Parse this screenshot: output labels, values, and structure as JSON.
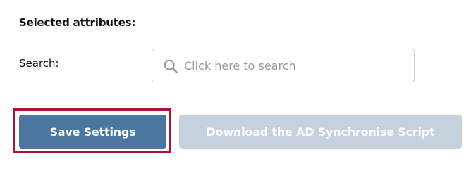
{
  "selected_attributes": {
    "title": "Selected attributes:"
  },
  "search": {
    "label": "Search:",
    "placeholder": "Click here to search",
    "value": "",
    "icon": "search-icon"
  },
  "actions": {
    "save_label": "Save Settings",
    "download_label": "Download the AD Synchronise Script"
  },
  "colors": {
    "save_button": "#4a76a0",
    "download_button_disabled": "#c5d1dd",
    "highlight_border": "#a8163a"
  }
}
